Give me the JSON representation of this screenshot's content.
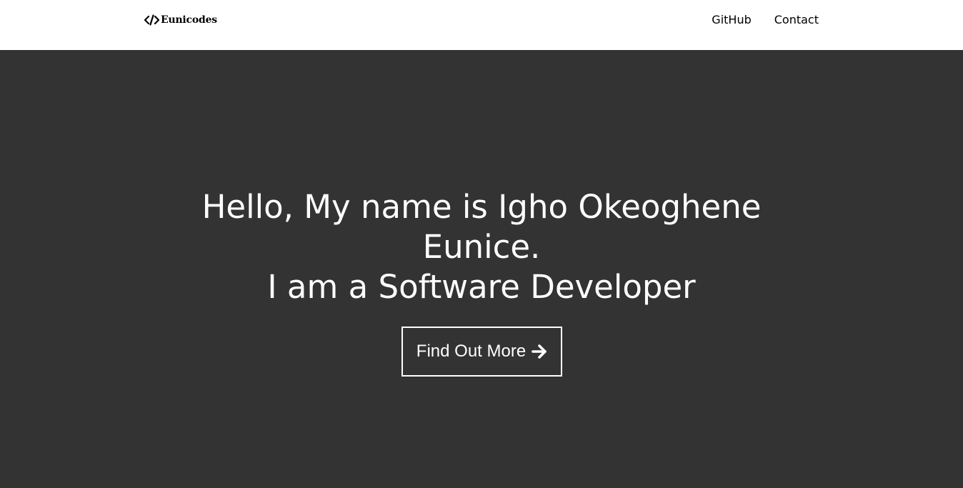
{
  "navbar": {
    "brand": {
      "icon": "code-icon",
      "label": "Eunicodes"
    },
    "links": [
      {
        "label": "GitHub"
      },
      {
        "label": "Contact"
      }
    ]
  },
  "hero": {
    "heading_line1": "Hello, My name is Igho Okeoghene Eunice.",
    "heading_line2": "I am a Software Developer",
    "cta": {
      "label": "Find Out More",
      "icon": "arrow-right-icon"
    }
  },
  "colors": {
    "nav_background": "#ffffff",
    "hero_background": "#333333",
    "hero_text": "#ffffff",
    "nav_text": "#000000"
  }
}
